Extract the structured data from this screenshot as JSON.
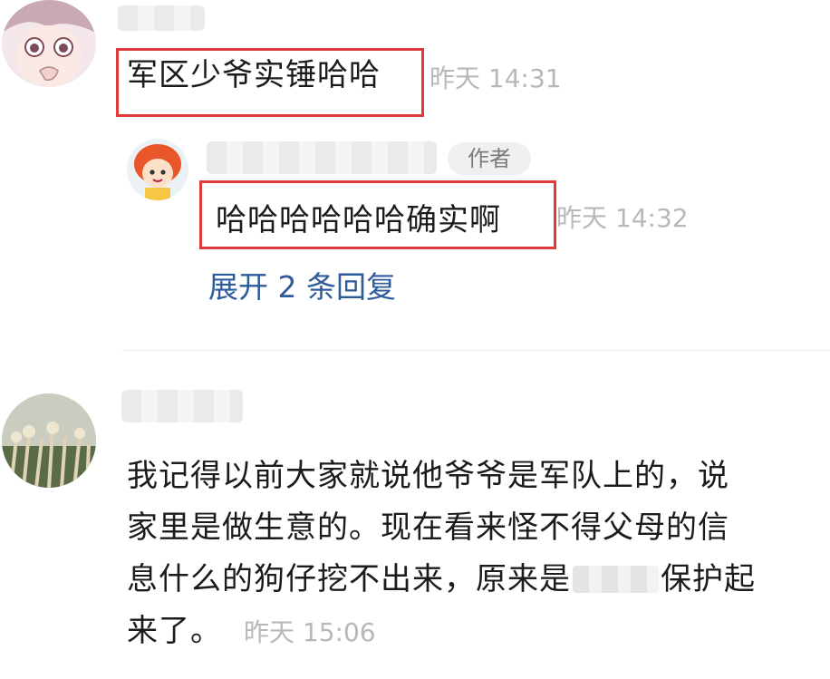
{
  "comments": [
    {
      "text": "军区少爷实锤哈哈",
      "time": "昨天 14:31",
      "avatar_icon": "anime-girl-avatar-icon",
      "reply": {
        "author_tag": "作者",
        "text": "哈哈哈哈哈哈确实啊",
        "time": "昨天 14:32",
        "avatar_icon": "cartoon-girl-avatar-icon"
      },
      "expand_replies": "展开 2 条回复"
    },
    {
      "avatar_icon": "reeds-landscape-avatar-icon",
      "lines": [
        "我记得以前大家就说他爷爷是军队上的，说",
        "家里是做生意的。现在看来怪不得父母的信",
        "息什么的狗仔挖不出来，原来是",
        "保护起",
        "来了。"
      ],
      "time": "昨天 15:06"
    }
  ],
  "colors": {
    "highlight": "#e03a3a",
    "link": "#2d5b9c",
    "timestamp": "#b8b8b8"
  }
}
